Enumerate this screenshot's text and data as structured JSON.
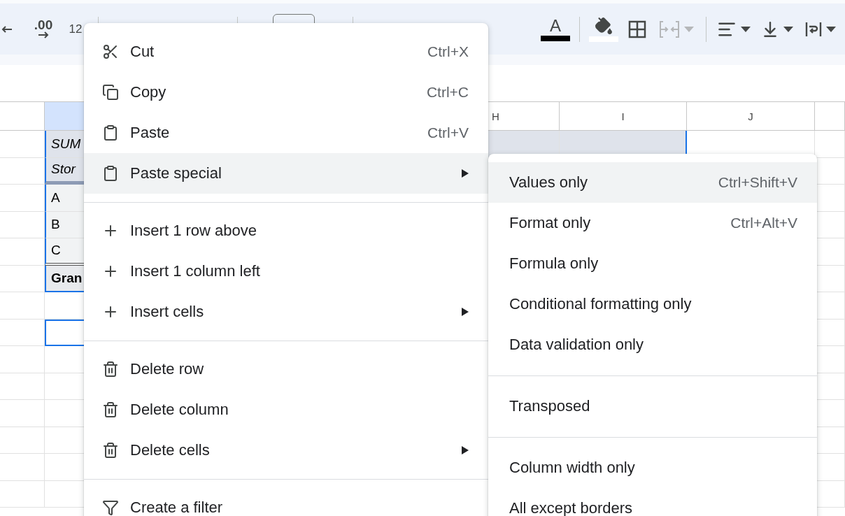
{
  "toolbar": {
    "left": [
      {
        "kind": "decrease_decimal"
      },
      {
        "kind": "increase_decimal",
        "label": ".00"
      },
      {
        "kind": "number_format",
        "label": "12"
      }
    ],
    "right": [
      {
        "kind": "text_color",
        "label": "A",
        "color": "#000000"
      },
      {
        "kind": "fill_color",
        "color": "#ffffff"
      },
      {
        "kind": "borders"
      },
      {
        "kind": "merge",
        "disabled": true
      },
      {
        "kind": "align"
      },
      {
        "kind": "valign"
      },
      {
        "kind": "wrap"
      }
    ]
  },
  "sheet": {
    "columns": [
      "H",
      "I",
      "J"
    ],
    "rows": [
      {
        "label": "SUM",
        "kind": "title",
        "in_range": true,
        "selected": false
      },
      {
        "label": "Stor",
        "kind": "title",
        "in_range": true,
        "selected": false
      },
      {
        "label": "A",
        "kind": "item",
        "in_range": true,
        "selected": false
      },
      {
        "label": "B",
        "kind": "item",
        "in_range": true,
        "selected": false
      },
      {
        "label": "C",
        "kind": "item",
        "in_range": true,
        "selected": false
      },
      {
        "label": "Gran",
        "kind": "total",
        "in_range": true,
        "selected": false
      },
      {
        "kind": "plain",
        "in_range": false,
        "selected": false
      },
      {
        "kind": "plain",
        "in_range": false,
        "selected": true
      },
      {
        "kind": "plain",
        "in_range": false,
        "selected": false
      },
      {
        "kind": "plain",
        "in_range": false,
        "selected": false
      },
      {
        "kind": "plain",
        "in_range": false,
        "selected": false
      },
      {
        "kind": "plain",
        "in_range": false,
        "selected": false
      },
      {
        "kind": "plain",
        "in_range": false,
        "selected": false
      },
      {
        "kind": "plain",
        "in_range": false,
        "selected": false
      }
    ]
  },
  "context_menu": {
    "groups": [
      [
        {
          "kind": "cut",
          "label": "Cut",
          "shortcut": "Ctrl+X",
          "submenu": false,
          "selected": false
        },
        {
          "kind": "copy",
          "label": "Copy",
          "shortcut": "Ctrl+C",
          "submenu": false,
          "selected": false
        },
        {
          "kind": "paste",
          "label": "Paste",
          "shortcut": "Ctrl+V",
          "submenu": false,
          "selected": false
        },
        {
          "kind": "paste",
          "label": "Paste special",
          "submenu": true,
          "selected": true
        }
      ],
      [
        {
          "kind": "plus",
          "label": "Insert 1 row above",
          "submenu": false,
          "selected": false
        },
        {
          "kind": "plus",
          "label": "Insert 1 column left",
          "submenu": false,
          "selected": false
        },
        {
          "kind": "plus",
          "label": "Insert cells",
          "submenu": true,
          "selected": false
        }
      ],
      [
        {
          "kind": "trash",
          "label": "Delete row",
          "submenu": false,
          "selected": false
        },
        {
          "kind": "trash",
          "label": "Delete column",
          "submenu": false,
          "selected": false
        },
        {
          "kind": "trash",
          "label": "Delete cells",
          "submenu": true,
          "selected": false
        }
      ],
      [
        {
          "kind": "filter",
          "label": "Create a filter",
          "submenu": false,
          "selected": false
        }
      ]
    ]
  },
  "submenu": {
    "groups": [
      [
        {
          "label": "Values only",
          "shortcut": "Ctrl+Shift+V",
          "selected": true
        },
        {
          "label": "Format only",
          "shortcut": "Ctrl+Alt+V",
          "selected": false
        },
        {
          "label": "Formula only",
          "selected": false
        },
        {
          "label": "Conditional formatting only",
          "selected": false
        },
        {
          "label": "Data validation only",
          "selected": false
        }
      ],
      [
        {
          "label": "Transposed",
          "selected": false
        }
      ],
      [
        {
          "label": "Column width only",
          "selected": false
        },
        {
          "label": "All except borders",
          "selected": false
        }
      ]
    ]
  }
}
